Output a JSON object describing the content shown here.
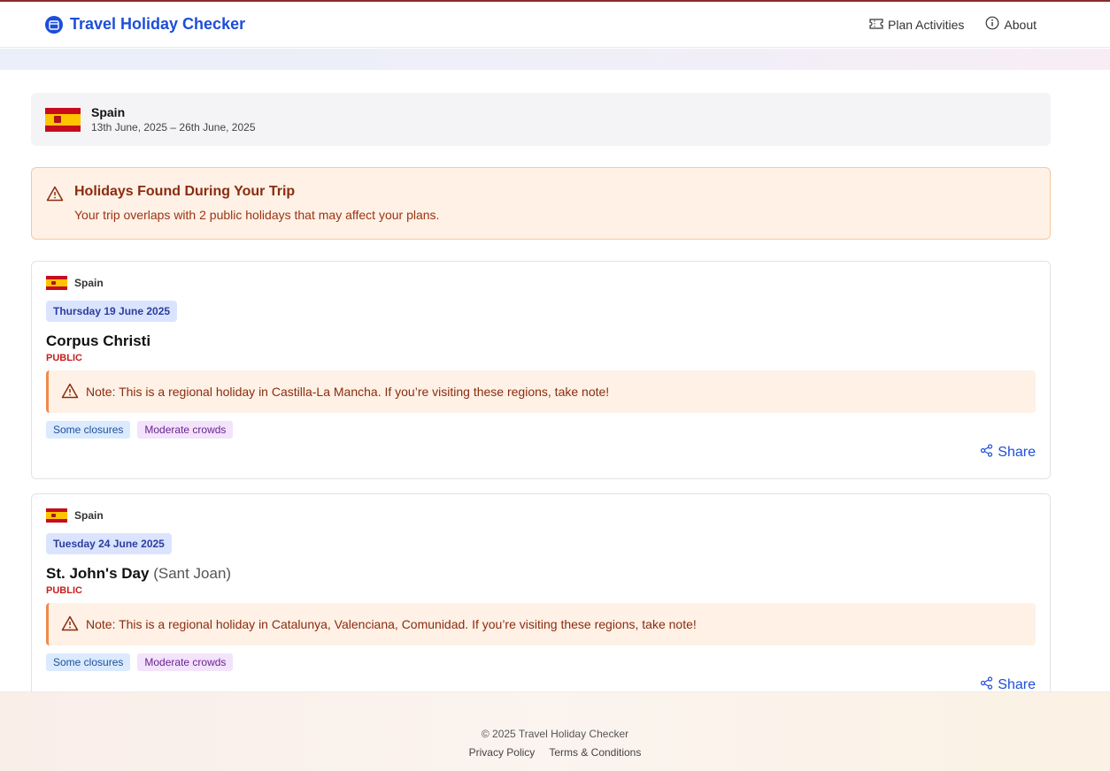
{
  "header": {
    "brand_title": "Travel Holiday Checker",
    "nav": [
      {
        "label": "Plan Activities",
        "icon": "ticket-icon"
      },
      {
        "label": "About",
        "icon": "info-icon"
      }
    ]
  },
  "trip": {
    "country": "Spain",
    "dates": "13th June, 2025 – 26th June, 2025",
    "flag": "spain-flag"
  },
  "alert": {
    "title": "Holidays Found During Your Trip",
    "text": "Your trip overlaps with 2 public holidays that may affect your plans."
  },
  "holidays": [
    {
      "country": "Spain",
      "date": "Thursday 19 June 2025",
      "name": "Corpus Christi",
      "local_name": "",
      "type": "PUBLIC",
      "note": "Note: This is a regional holiday in Castilla-La Mancha. If you’re visiting these regions, take note!",
      "tags": [
        "Some closures",
        "Moderate crowds"
      ],
      "share_label": "Share"
    },
    {
      "country": "Spain",
      "date": "Tuesday 24 June 2025",
      "name": "St. John's Day",
      "local_name": "(Sant Joan)",
      "type": "PUBLIC",
      "note": "Note: This is a regional holiday in Catalunya, Valenciana, Comunidad. If you’re visiting these regions, take note!",
      "tags": [
        "Some closures",
        "Moderate crowds"
      ],
      "share_label": "Share"
    }
  ],
  "footer": {
    "copyright": "© 2025 Travel Holiday Checker",
    "links": [
      "Privacy Policy",
      "Terms & Conditions"
    ]
  },
  "colors": {
    "brand": "#1d4ed8",
    "alert_bg": "#fff1e6",
    "public_red": "#c81e1e"
  }
}
